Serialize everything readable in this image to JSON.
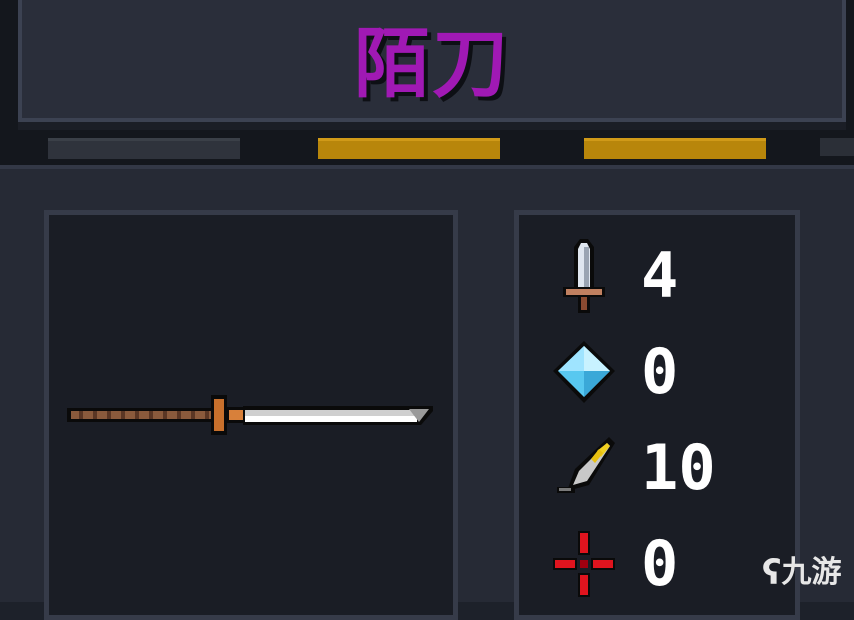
{
  "weapon": {
    "name": "陌刀",
    "name_color": "#a019b4"
  },
  "stats": [
    {
      "icon": "sword-icon",
      "value": "4"
    },
    {
      "icon": "crystal-icon",
      "value": "0"
    },
    {
      "icon": "feather-icon",
      "value": "10"
    },
    {
      "icon": "crosshair-icon",
      "value": "0"
    }
  ],
  "watermark": {
    "text": "九游"
  },
  "colors": {
    "gold_bar": "#b8860b",
    "grey_bar": "#2f333c"
  }
}
